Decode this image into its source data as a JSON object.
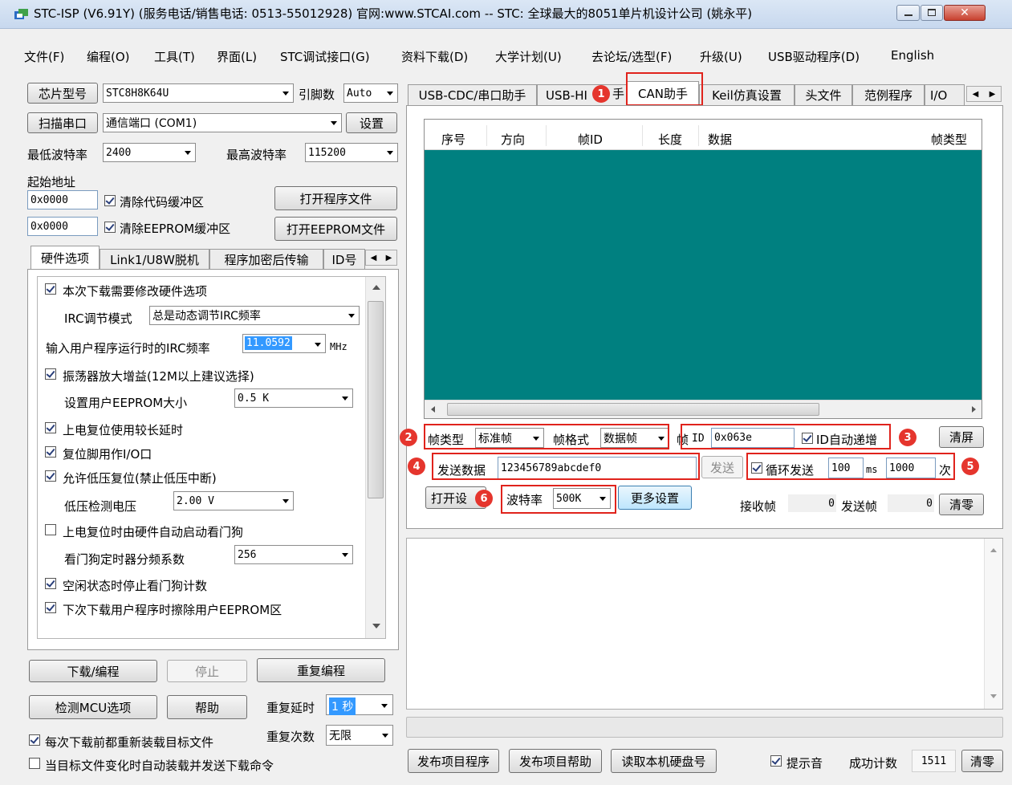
{
  "window": {
    "title": "STC-ISP (V6.91Y) (服务电话/销售电话: 0513-55012928) 官网:www.STCAI.com  -- STC: 全球最大的8051单片机设计公司 (姚永平)"
  },
  "menu": [
    "文件(F)",
    "编程(O)",
    "工具(T)",
    "界面(L)",
    "STC调试接口(G)",
    "资料下载(D)",
    "大学计划(U)",
    "去论坛/选型(F)",
    "升级(U)",
    "USB驱动程序(D)",
    "English"
  ],
  "left": {
    "chip_button": "芯片型号",
    "chip_value": "STC8H8K64U",
    "pin_label": "引脚数",
    "pin_value": "Auto",
    "scan_button": "扫描串口",
    "port_value": "通信端口  (COM1)",
    "settings_button": "设置",
    "min_baud_label": "最低波特率",
    "min_baud_value": "2400",
    "max_baud_label": "最高波特率",
    "max_baud_value": "115200",
    "start_addr_label": "起始地址",
    "addr1": "0x0000",
    "clear_code": "清除代码缓冲区",
    "open_program": "打开程序文件",
    "addr2": "0x0000",
    "clear_eeprom": "清除EEPROM缓冲区",
    "open_eeprom": "打开EEPROM文件",
    "tabs": [
      "硬件选项",
      "Link1/U8W脱机",
      "程序加密后传输",
      "ID号"
    ],
    "opt_modify_hw": "本次下载需要修改硬件选项",
    "irc_mode_label": "IRC调节模式",
    "irc_mode_value": "总是动态调节IRC频率",
    "irc_freq_label": "输入用户程序运行时的IRC频率",
    "irc_freq_value": "11.0592",
    "irc_freq_unit": "MHz",
    "opt_osc_gain": "振荡器放大增益(12M以上建议选择)",
    "eeprom_size_label": "设置用户EEPROM大小",
    "eeprom_size_value": "0.5 K",
    "opt_long_reset": "上电复位使用较长延时",
    "opt_reset_io": "复位脚用作I/O口",
    "opt_lvr": "允许低压复位(禁止低压中断)",
    "lvd_label": "低压检测电压",
    "lvd_value": "2.00 V",
    "opt_wdt_auto": "上电复位时由硬件自动启动看门狗",
    "wdt_div_label": "看门狗定时器分频系数",
    "wdt_div_value": "256",
    "opt_idle_wdt": "空闲状态时停止看门狗计数",
    "opt_erase_eeprom": "下次下载用户程序时擦除用户EEPROM区",
    "download_button": "下载/编程",
    "stop_button": "停止",
    "reprogram_button": "重复编程",
    "detect_button": "检测MCU选项",
    "help_button": "帮助",
    "repeat_delay_label": "重复延时",
    "repeat_delay_value": "1 秒",
    "repeat_count_label": "重复次数",
    "repeat_count_value": "无限",
    "reload_each": "每次下载前都重新装载目标文件",
    "auto_reload": "当目标文件变化时自动装载并发送下载命令"
  },
  "right": {
    "tabs": [
      "USB-CDC/串口助手",
      "USB-HI",
      "手",
      "CAN助手",
      "Keil仿真设置",
      "头文件",
      "范例程序",
      "I/O"
    ],
    "columns": [
      "序号",
      "方向",
      "帧ID",
      "长度",
      "数据",
      "帧类型"
    ],
    "frame_type_label": "帧类型",
    "frame_type_value": "标准帧",
    "frame_format_label": "帧格式",
    "frame_format_value": "数据帧",
    "frame_id_prefix": "帧",
    "frame_id_label": "ID",
    "frame_id_value": "0x063e",
    "id_auto_inc": "ID自动递增",
    "clear_screen": "清屏",
    "send_data_label": "发送数据",
    "send_data_value": "123456789abcdef0",
    "send_button": "发送",
    "loop_send": "循环发送",
    "loop_interval": "100",
    "loop_unit": "ms",
    "loop_count": "1000",
    "loop_count_unit": "次",
    "open_button": "打开设",
    "baud_label": "波特率",
    "baud_value": "500K",
    "more_settings": "更多设置",
    "recv_label": "接收帧",
    "recv_value": "0",
    "sent_label": "发送帧",
    "sent_value": "0",
    "reset_counts": "清零",
    "publish_program": "发布项目程序",
    "publish_help": "发布项目帮助",
    "read_hdd": "读取本机硬盘号",
    "beep": "提示音",
    "success_label": "成功计数",
    "success_value": "1511",
    "success_clear": "清零"
  },
  "badges": [
    "1",
    "2",
    "3",
    "4",
    "5",
    "6"
  ],
  "colors": {
    "teal": "#008080",
    "annotation_red": "#e0231c",
    "selection_blue": "#3399ff"
  }
}
